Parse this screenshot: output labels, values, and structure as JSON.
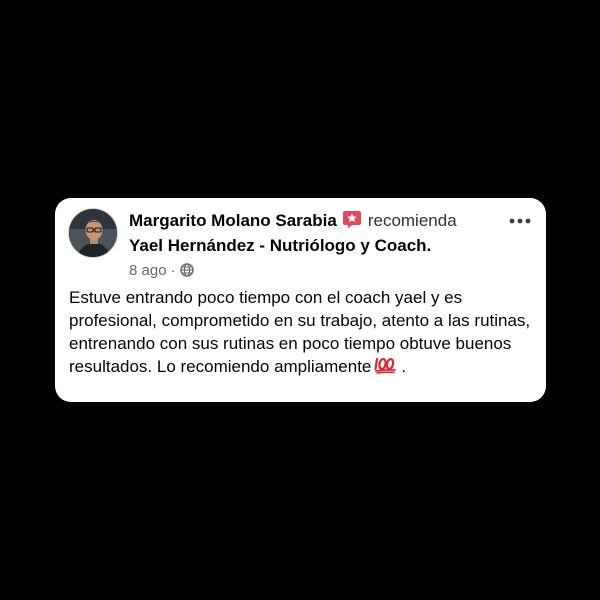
{
  "review": {
    "author": "Margarito Molano Sarabia",
    "recommend_icon": "recommendation-star-icon",
    "action": "recomienda",
    "page_name": "Yael Hernández - Nutriólogo y Coach.",
    "time": "8 ago",
    "separator": "·",
    "privacy_icon": "globe-icon",
    "more_icon": "more-options-icon",
    "body": "Estuve entrando poco tiempo con el coach yael y es profesional, comprometido en su trabajo, atento a las rutinas, entrenando con sus rutinas en poco tiempo obtuve buenos resultados. Lo recomiendo ampliamente",
    "emoji": "hundred-points-emoji",
    "body_end": "."
  },
  "colors": {
    "background": "#000000",
    "card": "#ffffff",
    "recommend_badge": "#e4475e",
    "emoji_red": "#e0262f",
    "meta_text": "#65676b"
  }
}
